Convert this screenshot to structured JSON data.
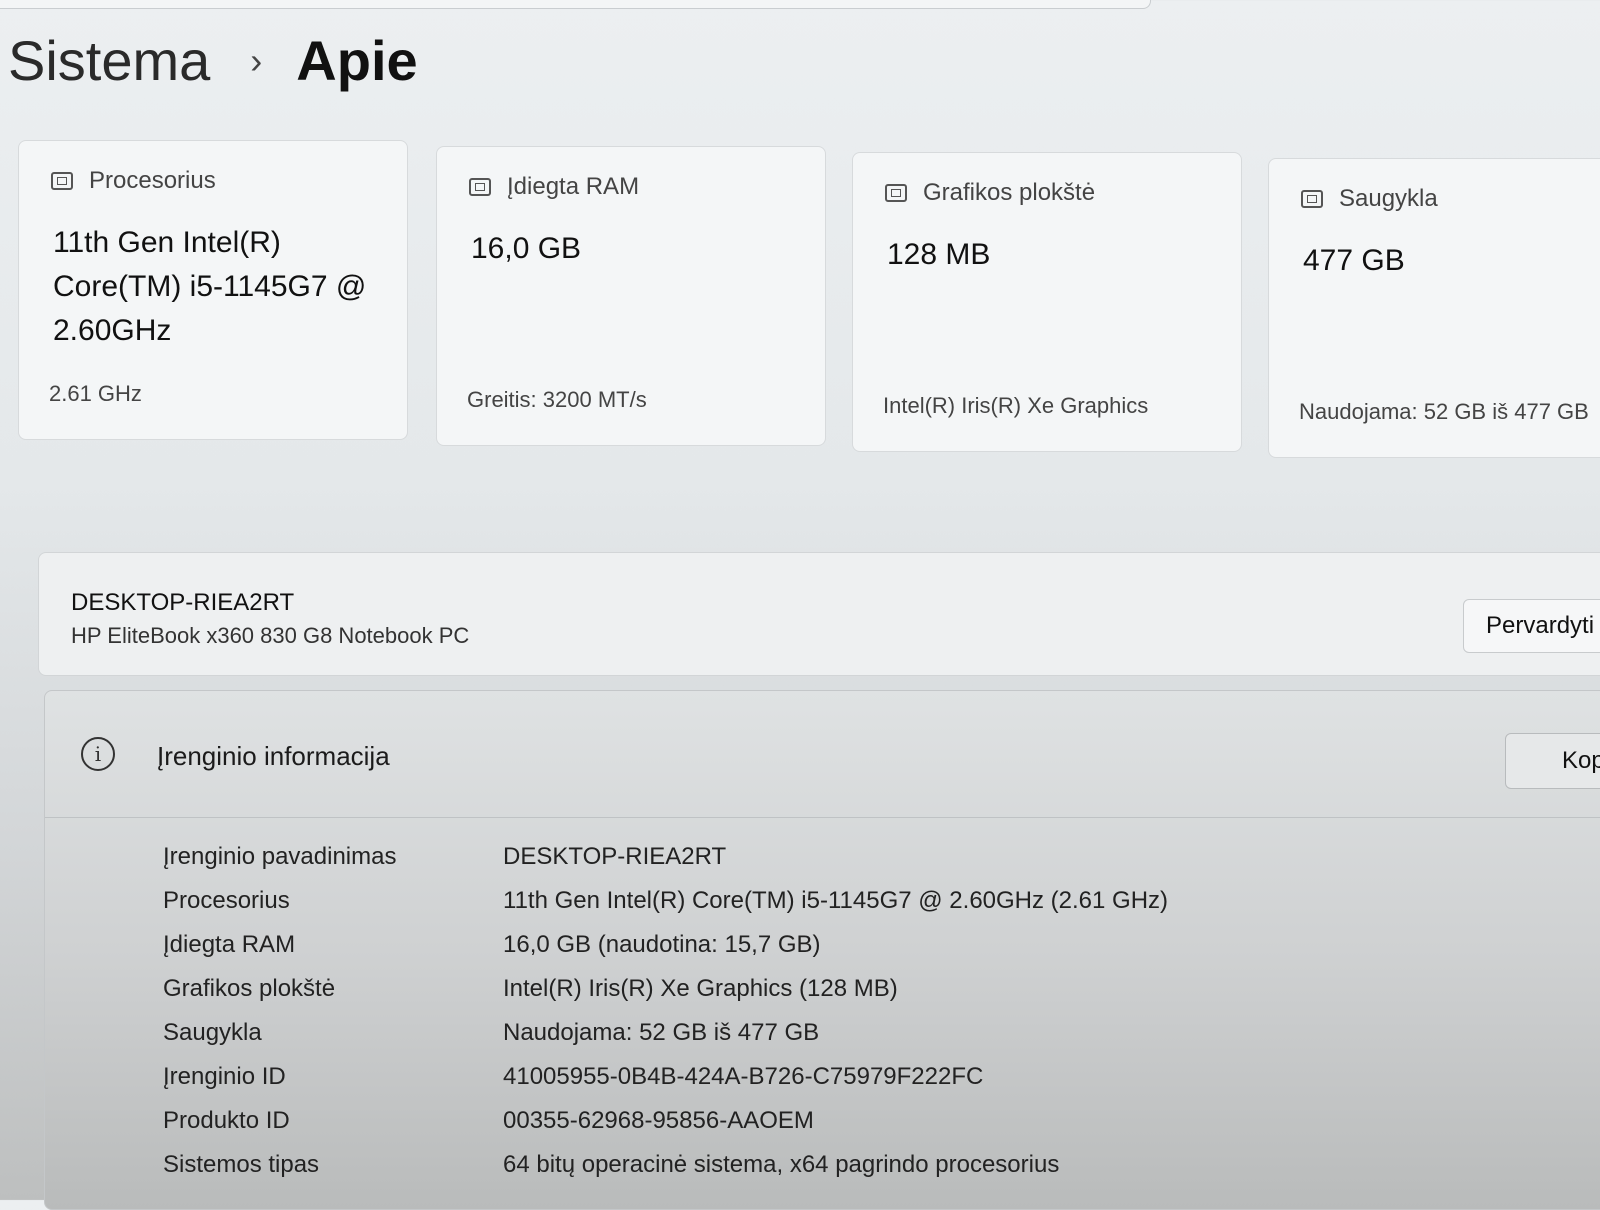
{
  "breadcrumb": {
    "parent": "Sistema",
    "separator": "›",
    "current": "Apie"
  },
  "cards": [
    {
      "title": "Procesorius",
      "value": "11th Gen Intel(R) Core(TM) i5-1145G7 @ 2.60GHz",
      "sub": "2.61 GHz",
      "icon": "processor-icon"
    },
    {
      "title": "Įdiegta RAM",
      "value": "16,0 GB",
      "sub": "Greitis: 3200 MT/s",
      "icon": "ram-icon"
    },
    {
      "title": "Grafikos plokštė",
      "value": "128 MB",
      "sub": "Intel(R) Iris(R) Xe Graphics",
      "icon": "graphics-icon"
    },
    {
      "title": "Saugykla",
      "value": "477 GB",
      "sub": "Naudojama: 52 GB iš 477 GB",
      "icon": "storage-icon"
    }
  ],
  "device": {
    "name": "DESKTOP-RIEA2RT",
    "model": "HP EliteBook x360 830 G8 Notebook PC",
    "rename_label": "Pervardyti"
  },
  "info": {
    "title": "Įrenginio informacija",
    "copy_label": "Kop",
    "rows": [
      {
        "label": "Įrenginio pavadinimas",
        "value": "DESKTOP-RIEA2RT"
      },
      {
        "label": "Procesorius",
        "value": "11th Gen Intel(R) Core(TM) i5-1145G7 @ 2.60GHz (2.61 GHz)"
      },
      {
        "label": "Įdiegta RAM",
        "value": "16,0 GB (naudotina: 15,7 GB)"
      },
      {
        "label": "Grafikos plokštė",
        "value": "Intel(R) Iris(R) Xe Graphics (128 MB)"
      },
      {
        "label": "Saugykla",
        "value": "Naudojama: 52 GB iš 477 GB"
      },
      {
        "label": "Įrenginio ID",
        "value": "41005955-0B4B-424A-B726-C75979F222FC"
      },
      {
        "label": "Produkto ID",
        "value": "00355-62968-95856-AAOEM"
      },
      {
        "label": "Sistemos tipas",
        "value": "64 bitų operacinė sistema, x64 pagrindo procesorius"
      }
    ]
  }
}
